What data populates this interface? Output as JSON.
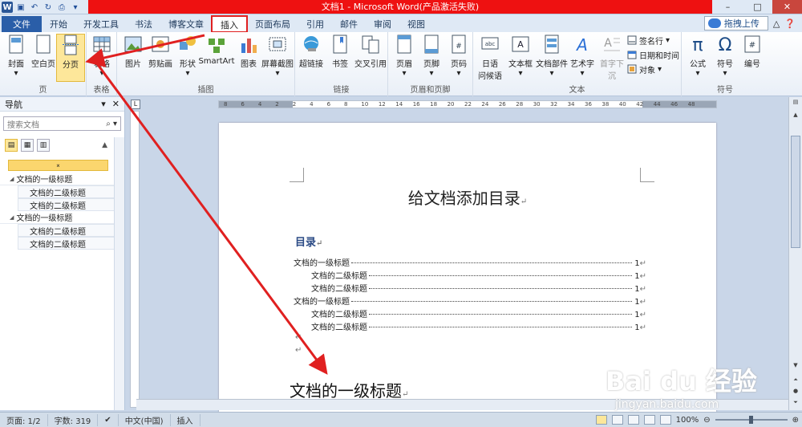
{
  "window": {
    "title": "文档1 - Microsoft Word(产品激活失败)"
  },
  "tabs": [
    "文件",
    "开始",
    "开发工具",
    "书法",
    "博客文章",
    "插入",
    "页面布局",
    "引用",
    "邮件",
    "审阅",
    "视图"
  ],
  "active_tab": "插入",
  "upload_button": "拖拽上传",
  "ribbon": {
    "groups": [
      {
        "label": "页",
        "buttons": [
          "封面",
          "空白页",
          "分页"
        ]
      },
      {
        "label": "表格",
        "buttons": [
          "表格"
        ]
      },
      {
        "label": "插图",
        "buttons": [
          "图片",
          "剪贴画",
          "形状",
          "SmartArt",
          "图表",
          "屏幕截图"
        ]
      },
      {
        "label": "链接",
        "buttons": [
          "超链接",
          "书签",
          "交叉引用"
        ]
      },
      {
        "label": "页眉和页脚",
        "buttons": [
          "页眉",
          "页脚",
          "页码"
        ]
      },
      {
        "label": "文本",
        "buttons": [
          "日期问候语",
          "文本框",
          "文档部件",
          "艺术字",
          "首字下沉"
        ],
        "small": [
          "签名行",
          "日期和时间",
          "对象"
        ]
      },
      {
        "label": "符号",
        "buttons": [
          "公式",
          "符号",
          "编号"
        ]
      }
    ],
    "date_greeting_line1": "日语",
    "date_greeting_line2": "问候语"
  },
  "nav": {
    "title": "导航",
    "search_placeholder": "搜索文档",
    "items": [
      {
        "level": 1,
        "text": "文档的一级标题"
      },
      {
        "level": 2,
        "text": "文档的二级标题"
      },
      {
        "level": 2,
        "text": "文档的二级标题"
      },
      {
        "level": 1,
        "text": "文档的一级标题"
      },
      {
        "level": 2,
        "text": "文档的二级标题"
      },
      {
        "level": 2,
        "text": "文档的二级标题"
      }
    ]
  },
  "ruler": {
    "labels": [
      "8",
      "6",
      "4",
      "2",
      "2",
      "4",
      "6",
      "8",
      "10",
      "12",
      "14",
      "16",
      "18",
      "20",
      "22",
      "24",
      "26",
      "28",
      "30",
      "32",
      "34",
      "36",
      "38",
      "40",
      "42",
      "44",
      "46",
      "48"
    ]
  },
  "document": {
    "title": "给文档添加目录",
    "toc_heading": "目录",
    "toc": [
      {
        "level": 1,
        "text": "文档的一级标题",
        "page": "1"
      },
      {
        "level": 2,
        "text": "文档的二级标题",
        "page": "1"
      },
      {
        "level": 2,
        "text": "文档的二级标题",
        "page": "1"
      },
      {
        "level": 1,
        "text": "文档的一级标题",
        "page": "1"
      },
      {
        "level": 2,
        "text": "文档的二级标题",
        "page": "1"
      },
      {
        "level": 2,
        "text": "文档的二级标题",
        "page": "1"
      }
    ],
    "heading1": "文档的一级标题",
    "para_mark": "↵"
  },
  "status": {
    "page": "页面: 1/2",
    "words": "字数: 319",
    "language": "中文(中国)",
    "mode": "插入",
    "zoom": "100%"
  },
  "watermark": {
    "brand": "Bai du 经验",
    "url": "jingyan.baidu.com"
  },
  "colors": {
    "title_bar_highlight": "#ee1111",
    "file_tab": "#2a5ea8",
    "annotation_arrow": "#e02020"
  }
}
